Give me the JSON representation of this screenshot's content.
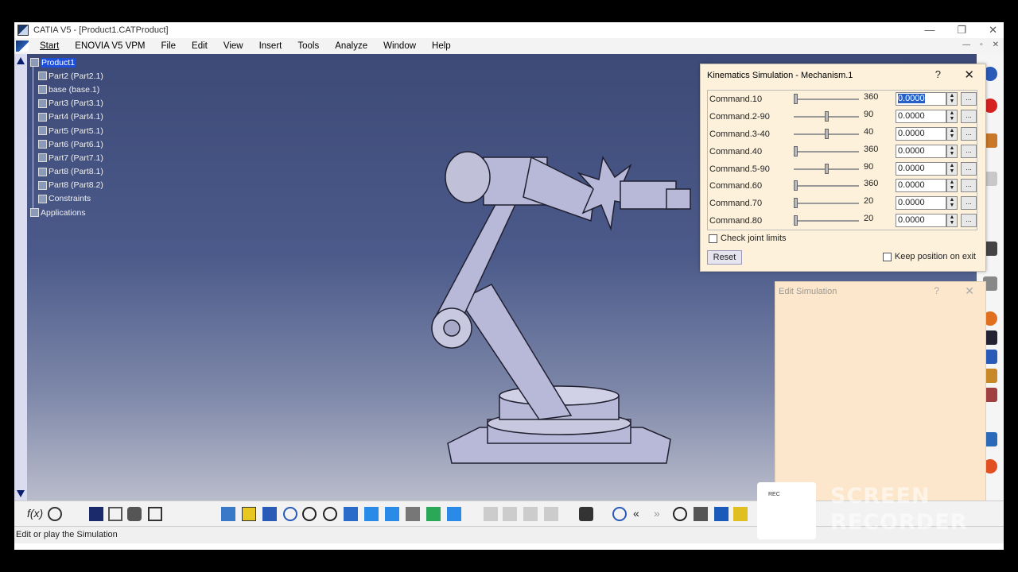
{
  "window": {
    "title": "CATIA V5 - [Product1.CATProduct]",
    "controls": [
      "—",
      "❐",
      "✕"
    ]
  },
  "menu": {
    "items": [
      "Start",
      "ENOVIA V5 VPM",
      "File",
      "Edit",
      "View",
      "Insert",
      "Tools",
      "Analyze",
      "Window",
      "Help"
    ],
    "mdi_controls": [
      "—",
      "▫",
      "✕"
    ]
  },
  "tree": {
    "root": "Product1",
    "nodes": [
      "Part2 (Part2.1)",
      "base (base.1)",
      "Part3 (Part3.1)",
      "Part4 (Part4.1)",
      "Part5 (Part5.1)",
      "Part6 (Part6.1)",
      "Part7 (Part7.1)",
      "Part8 (Part8.1)",
      "Part8 (Part8.2)",
      "Constraints",
      "Applications"
    ]
  },
  "kinematics": {
    "title": "Kinematics Simulation - Mechanism.1",
    "help": "?",
    "close": "✕",
    "commands": [
      {
        "name": "Command.1",
        "min": "0",
        "max": "360",
        "value": "0.0000",
        "level": 0.0
      },
      {
        "name": "Command.2",
        "min": "-90",
        "max": "90",
        "value": "0.0000",
        "level": 0.5
      },
      {
        "name": "Command.3",
        "min": "-40",
        "max": "40",
        "value": "0.0000",
        "level": 0.5
      },
      {
        "name": "Command.4",
        "min": "0",
        "max": "360",
        "value": "0.0000",
        "level": 0.0
      },
      {
        "name": "Command.5",
        "min": "-90",
        "max": "90",
        "value": "0.0000",
        "level": 0.5
      },
      {
        "name": "Command.6",
        "min": "0",
        "max": "360",
        "value": "0.0000",
        "level": 0.0
      },
      {
        "name": "Command.7",
        "min": "0",
        "max": "20",
        "value": "0.0000",
        "level": 0.0
      },
      {
        "name": "Command.8",
        "min": "0",
        "max": "20",
        "value": "0.0000",
        "level": 0.0
      }
    ],
    "check_joint_limits": "Check joint limits",
    "reset": "Reset",
    "keep_position": "Keep position on exit"
  },
  "edit_simulation": {
    "title": "Edit Simulation",
    "help": "?",
    "close": "✕"
  },
  "status": {
    "text": "Edit or play the Simulation"
  },
  "watermark": {
    "line1": "SCREEN",
    "line2": "RECORDER",
    "badge": "REC"
  }
}
